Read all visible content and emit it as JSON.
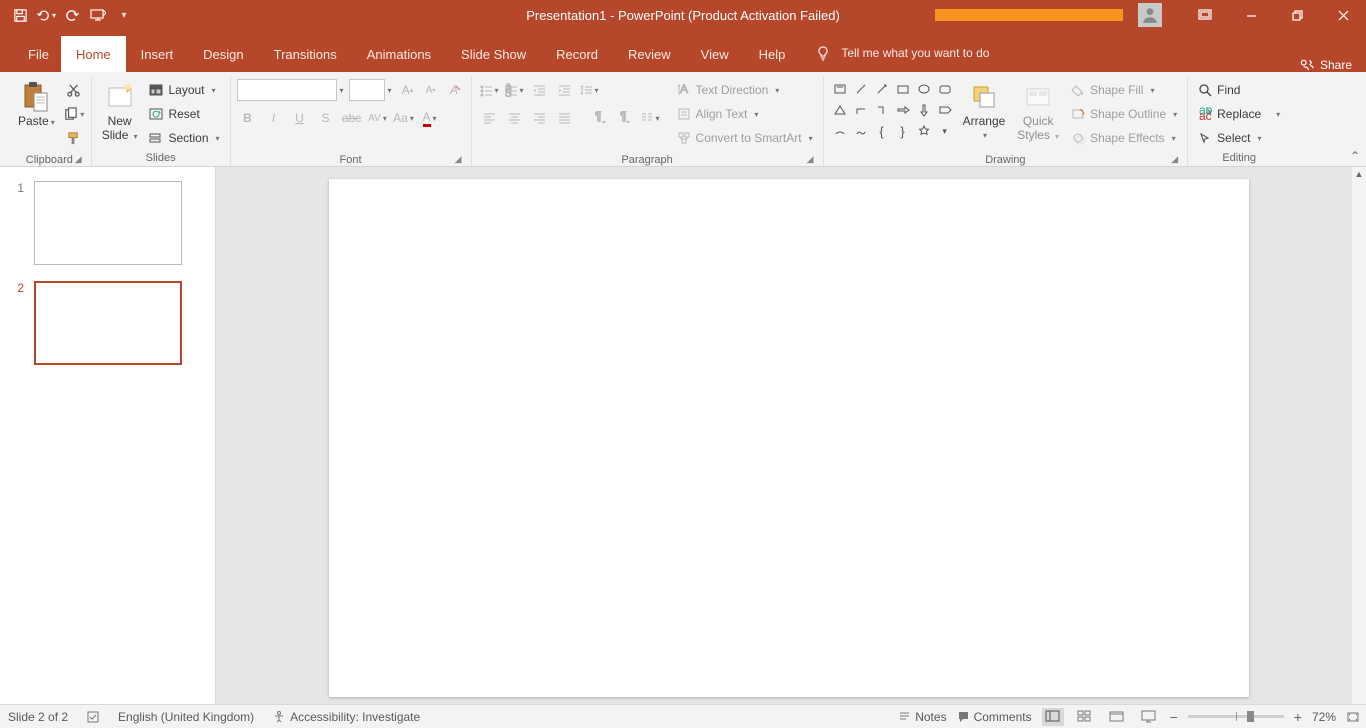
{
  "title": "Presentation1  -  PowerPoint (Product Activation Failed)",
  "tabs": {
    "file": "File",
    "home": "Home",
    "insert": "Insert",
    "design": "Design",
    "transitions": "Transitions",
    "animations": "Animations",
    "slideshow": "Slide Show",
    "record": "Record",
    "review": "Review",
    "view": "View",
    "help": "Help",
    "tellme": "Tell me what you want to do"
  },
  "share": "Share",
  "groups": {
    "clipboard": "Clipboard",
    "slides": "Slides",
    "font": "Font",
    "paragraph": "Paragraph",
    "drawing": "Drawing",
    "editing": "Editing"
  },
  "clipboard": {
    "paste": "Paste"
  },
  "slides": {
    "new": "New\nSlide",
    "layout": "Layout",
    "reset": "Reset",
    "section": "Section"
  },
  "paragraph": {
    "textdir": "Text Direction",
    "align": "Align Text",
    "smartart": "Convert to SmartArt"
  },
  "drawing": {
    "arrange": "Arrange",
    "quick": "Quick\nStyles",
    "fill": "Shape Fill",
    "outline": "Shape Outline",
    "effects": "Shape Effects"
  },
  "editing": {
    "find": "Find",
    "replace": "Replace",
    "select": "Select"
  },
  "thumbs": [
    {
      "n": "1"
    },
    {
      "n": "2"
    }
  ],
  "status": {
    "slide": "Slide 2 of 2",
    "lang": "English (United Kingdom)",
    "access": "Accessibility: Investigate",
    "notes": "Notes",
    "comments": "Comments",
    "zoom": "72%"
  }
}
